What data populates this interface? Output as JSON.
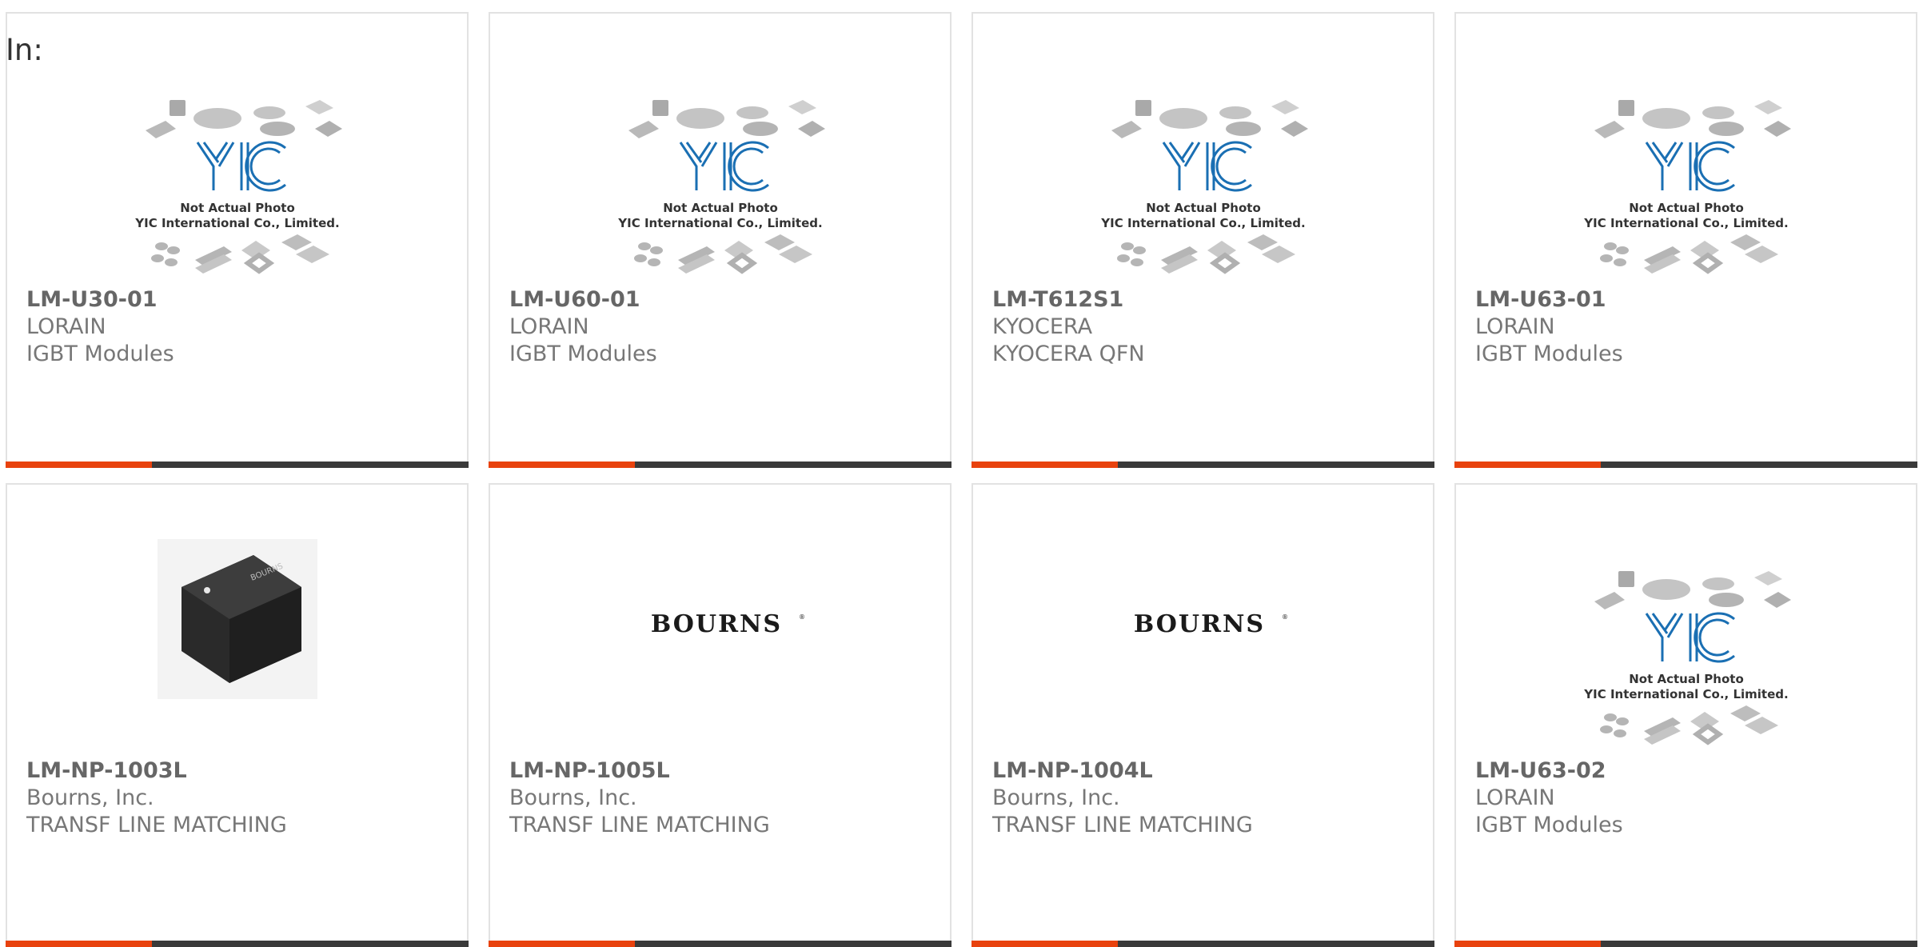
{
  "header": {
    "in_label": "In:"
  },
  "placeholder": {
    "line1": "Not Actual Photo",
    "line2": "YIC International Co., Limited."
  },
  "bourns_logo_text": "BOURNS",
  "colors": {
    "accent": "#e8420e",
    "bar": "#3a3a3a",
    "border": "#e2e2e2",
    "text": "#666666"
  },
  "products": [
    {
      "part_number": "LM-U30-01",
      "manufacturer": "LORAIN",
      "category": "IGBT Modules",
      "image": "yic-placeholder"
    },
    {
      "part_number": "LM-U60-01",
      "manufacturer": "LORAIN",
      "category": "IGBT Modules",
      "image": "yic-placeholder"
    },
    {
      "part_number": "LM-T612S1",
      "manufacturer": "KYOCERA",
      "category": "KYOCERA QFN",
      "image": "yic-placeholder"
    },
    {
      "part_number": "LM-U63-01",
      "manufacturer": "LORAIN",
      "category": "IGBT Modules",
      "image": "yic-placeholder"
    },
    {
      "part_number": "LM-NP-1003L",
      "manufacturer": "Bourns, Inc.",
      "category": "TRANSF LINE MATCHING",
      "image": "black-transformer-photo"
    },
    {
      "part_number": "LM-NP-1005L",
      "manufacturer": "Bourns, Inc.",
      "category": "TRANSF LINE MATCHING",
      "image": "bourns-logo"
    },
    {
      "part_number": "LM-NP-1004L",
      "manufacturer": "Bourns, Inc.",
      "category": "TRANSF LINE MATCHING",
      "image": "bourns-logo"
    },
    {
      "part_number": "LM-U63-02",
      "manufacturer": "LORAIN",
      "category": "IGBT Modules",
      "image": "yic-placeholder"
    }
  ]
}
